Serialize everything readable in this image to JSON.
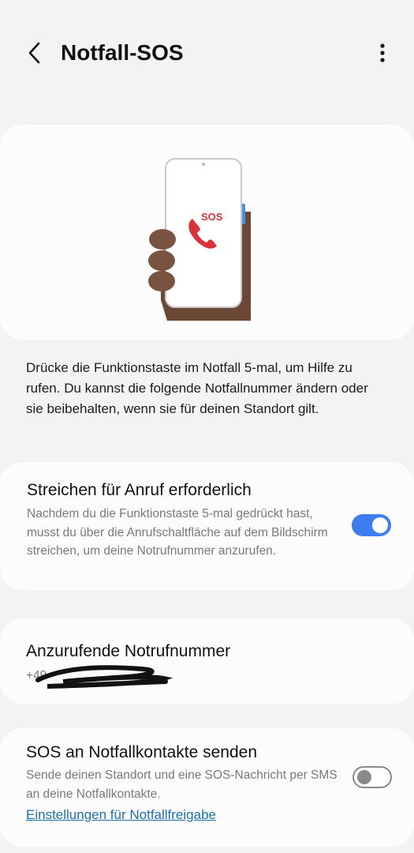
{
  "header": {
    "back_icon": "chevron-left-icon",
    "title": "Notfall-SOS",
    "more_icon": "more-vertical-icon"
  },
  "illustration": {
    "badge_text": "SOS",
    "phone_icon": "phone-icon"
  },
  "description": "Drücke die Funktionstaste im Notfall 5-mal, um Hilfe zu rufen. Du kannst die folgende Notfallnummer ändern oder sie beibehalten, wenn sie für deinen Standort gilt.",
  "swipe_setting": {
    "title": "Streichen für Anruf erforderlich",
    "subtitle": "Nachdem du die Funktionstaste 5-mal gedrückt hast, musst du über die Anrufschaltfläche auf dem Bildschirm streichen, um deine Notrufnummer anzurufen.",
    "enabled": true
  },
  "number_setting": {
    "title": "Anzurufende Notrufnummer",
    "value_visible": "+49"
  },
  "sos_setting": {
    "title": "SOS an Notfallkontakte senden",
    "subtitle": "Sende deinen Standort und eine SOS-Nachricht per SMS an deine Notfallkontakte.",
    "enabled": false,
    "link": "Einstellungen für Notfallfreigabe"
  },
  "colors": {
    "accent": "#3e7cf0",
    "sos_red": "#d9323a",
    "link": "#1f6fa8",
    "background": "#f3f3f5"
  }
}
